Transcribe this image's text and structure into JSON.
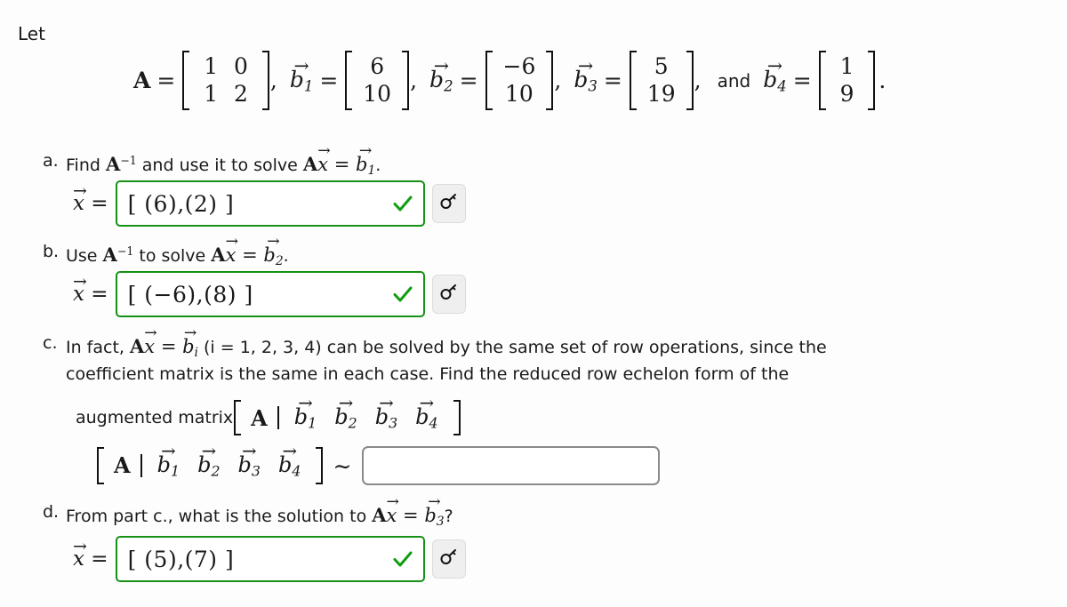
{
  "page": {
    "intro_label": "Let",
    "background": "#fdfdfd",
    "text_color": "#1a1a1a"
  },
  "colors": {
    "correct_green": "#159115",
    "check_green": "#0f9d0f",
    "empty_box_border": "#8a8a8a",
    "key_button_bg": "#efefef"
  },
  "definitions": {
    "matrix_A": {
      "name": "A",
      "rows": [
        [
          "1",
          "0"
        ],
        [
          "1",
          "2"
        ]
      ]
    },
    "vectors": [
      {
        "name": "b",
        "index": "1",
        "entries": [
          "6",
          "10"
        ]
      },
      {
        "name": "b",
        "index": "2",
        "entries": [
          "−6",
          "10"
        ]
      },
      {
        "name": "b",
        "index": "3",
        "entries": [
          "5",
          "19"
        ]
      },
      {
        "name": "b",
        "index": "4",
        "entries": [
          "1",
          "9"
        ]
      }
    ],
    "equals": "=",
    "comma": ",",
    "and_word": "and",
    "period": "."
  },
  "parts": {
    "a": {
      "marker": "a.",
      "prompt_pre": "Find ",
      "prompt_A": "A",
      "prompt_exp": "−1",
      "prompt_mid": " and use it to solve ",
      "prompt_Ax": "A",
      "prompt_x": "x",
      "prompt_eq": " = ",
      "prompt_b": "b",
      "prompt_bsub": "1",
      "prompt_end": ".",
      "answer_label": "x",
      "answer_equals": "=",
      "answer_value": "[ (6),(2) ]",
      "status": "correct",
      "check_glyph": "✓",
      "key_button_name": "answer-key-button"
    },
    "b": {
      "marker": "b.",
      "prompt_pre": "Use ",
      "prompt_A": "A",
      "prompt_exp": "−1",
      "prompt_mid": " to solve ",
      "prompt_Ax": "A",
      "prompt_x": "x",
      "prompt_eq": " = ",
      "prompt_b": "b",
      "prompt_bsub": "2",
      "prompt_end": ".",
      "answer_label": "x",
      "answer_equals": "=",
      "answer_value": "[ (−6),(8) ]",
      "status": "correct",
      "check_glyph": "✓",
      "key_button_name": "answer-key-button"
    },
    "c": {
      "marker": "c.",
      "line1_pre": "In fact, ",
      "line1_A": "A",
      "line1_x": "x",
      "line1_eq": " = ",
      "line1_b": "b",
      "line1_bsub": "i",
      "line1_paren": " (i = 1, 2, 3, 4) can be solved by the same set of row operations, since the",
      "line2": "coefficient matrix is the same in each case. Find the reduced row echelon form of the",
      "line3_pre": "augmented matrix ",
      "augmented_matrix": {
        "left_label": "A",
        "divider": "|",
        "columns": [
          {
            "name": "b",
            "index": "1"
          },
          {
            "name": "b",
            "index": "2"
          },
          {
            "name": "b",
            "index": "3"
          },
          {
            "name": "b",
            "index": "4"
          }
        ]
      },
      "similar_symbol": "∼",
      "answer_value": "",
      "answer_placeholder": "",
      "status": "empty"
    },
    "d": {
      "marker": "d.",
      "prompt_pre": "From part c., what is the solution to ",
      "prompt_A": "A",
      "prompt_x": "x",
      "prompt_eq": " = ",
      "prompt_b": "b",
      "prompt_bsub": "3",
      "prompt_end": "?",
      "answer_label": "x",
      "answer_equals": "=",
      "answer_value": "[ (5),(7) ]",
      "status": "correct",
      "check_glyph": "✓",
      "key_button_name": "answer-key-button"
    }
  },
  "icons": {
    "key": "key-icon",
    "check": "check-icon"
  }
}
